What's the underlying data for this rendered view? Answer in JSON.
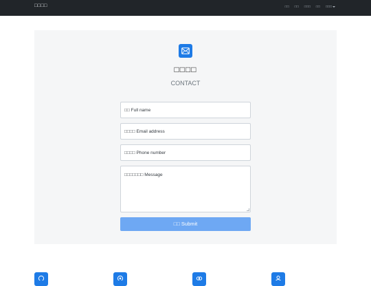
{
  "navbar": {
    "brand": "□□□□",
    "items": [
      "□□",
      "□□",
      "□□□",
      "□□",
      "□□□"
    ]
  },
  "contact": {
    "heading": "□□□□",
    "subheading": "CONTACT",
    "fields": {
      "name": "□□ Full name",
      "email": "□□□□ Email address",
      "phone": "□□□□ Phone number",
      "message": "□□□□□□□ Message"
    },
    "submit_label": "□□ Submit"
  },
  "bottom_icons": [
    "chat-icon",
    "location-icon",
    "users-icon",
    "person-icon"
  ],
  "colors": {
    "navbar": "#212529",
    "accent": "#1e7be6",
    "submit": "#6ea8f3",
    "panel": "#f5f6f7"
  }
}
